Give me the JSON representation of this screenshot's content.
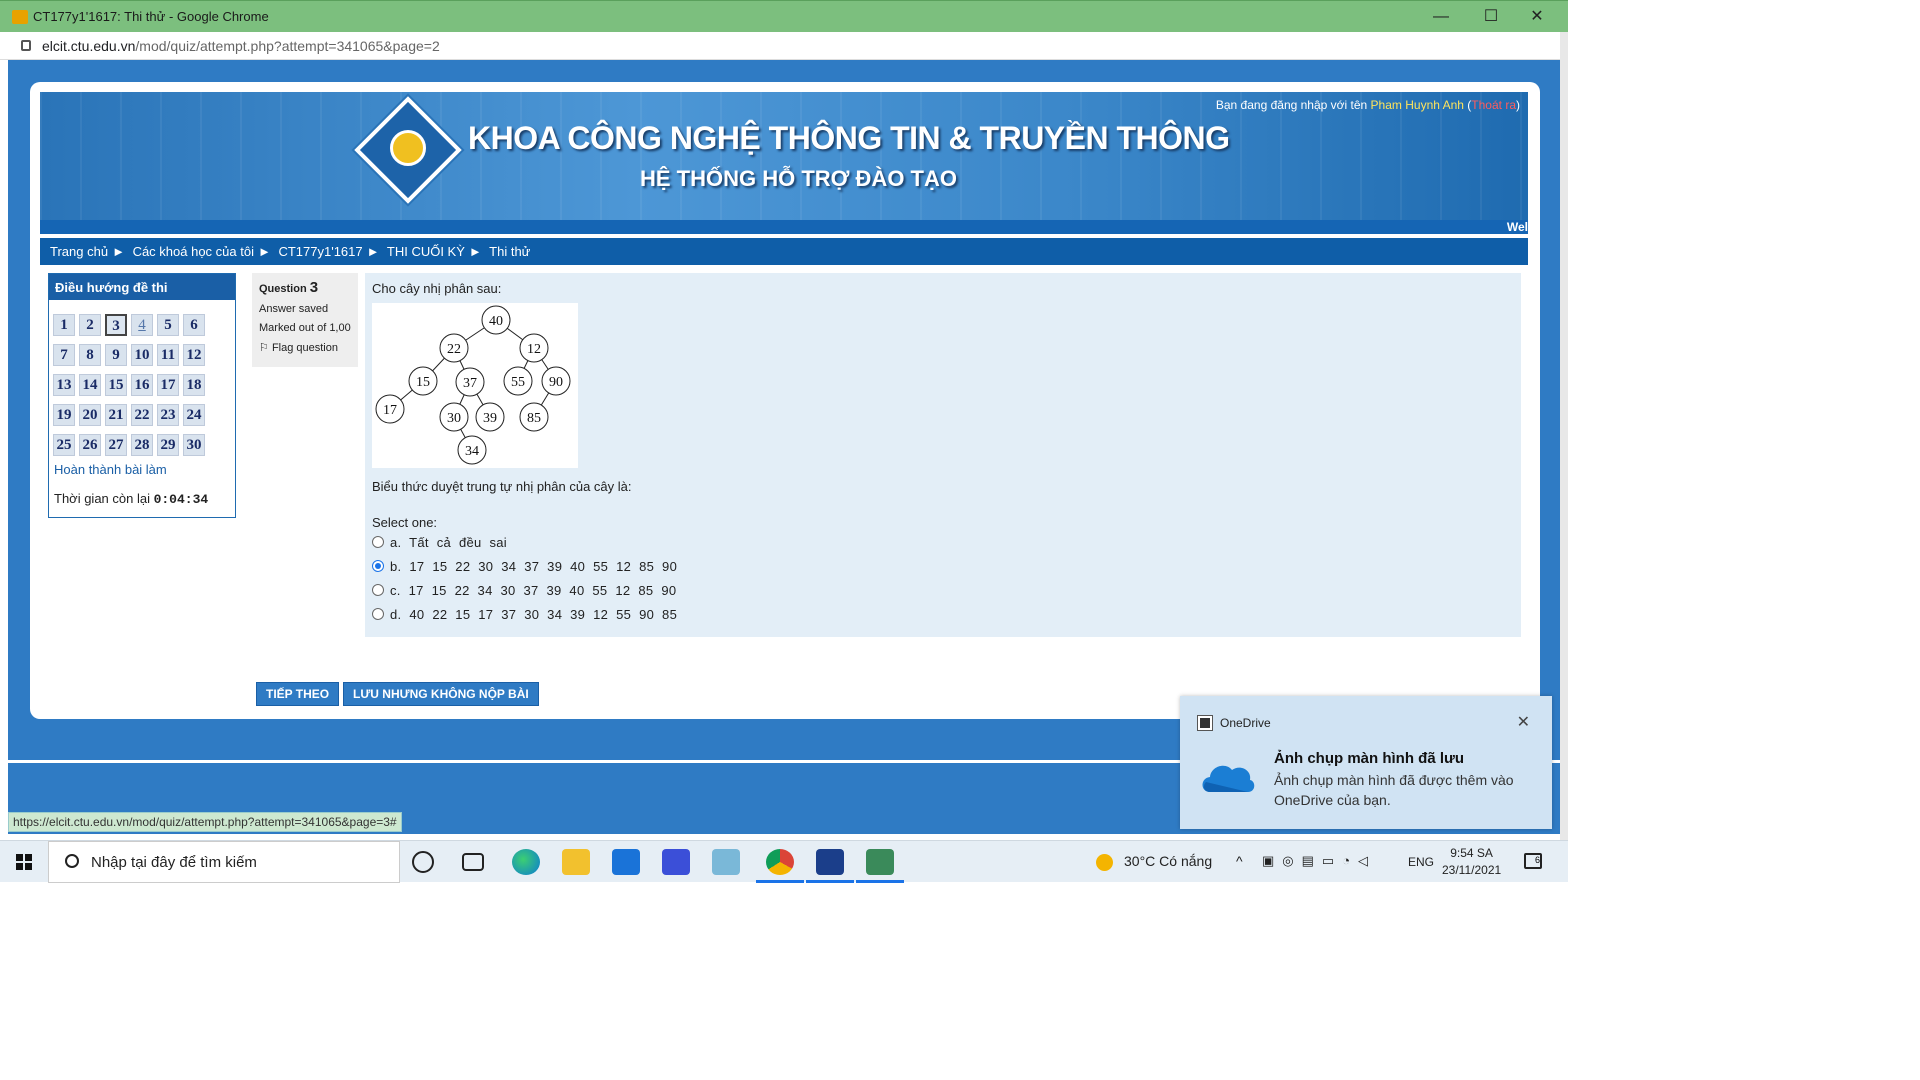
{
  "window": {
    "title": "CT177y1'1617: Thi thử - Google Chrome",
    "minimize": "—",
    "maximize": "☐",
    "close": "✕"
  },
  "address": {
    "domain": "elcit.ctu.edu.vn",
    "path": "/mod/quiz/attempt.php?attempt=341065&page=2"
  },
  "banner": {
    "heading": "KHOA CÔNG NGHỆ THÔNG TIN & TRUYỀN THÔNG",
    "subheading": "HỆ THỐNG HỖ TRỢ ĐÀO TẠO",
    "login_prefix": "Bạn đang đăng nhập với tên ",
    "user": "Pham Huynh Anh",
    "logout": "Thoát ra",
    "marquee": "Wel"
  },
  "breadcrumb": [
    "Trang chủ",
    "Các khoá học của tôi",
    "CT177y1'1617",
    "THI CUỐI KỲ",
    "Thi thử"
  ],
  "breadcrumb_sep": "►",
  "nav": {
    "title": "Điều hướng đề thi",
    "questions": [
      "1",
      "2",
      "3",
      "4",
      "5",
      "6",
      "7",
      "8",
      "9",
      "10",
      "11",
      "12",
      "13",
      "14",
      "15",
      "16",
      "17",
      "18",
      "19",
      "20",
      "21",
      "22",
      "23",
      "24",
      "25",
      "26",
      "27",
      "28",
      "29",
      "30"
    ],
    "current": "3",
    "finish": "Hoàn thành bài làm",
    "time_label": "Thời gian còn lại ",
    "time_value": "0:04:34"
  },
  "qinfo": {
    "label": "Question ",
    "number": "3",
    "state": "Answer saved",
    "marks": "Marked out of 1,00",
    "flag": "Flag question"
  },
  "question": {
    "stem": "Cho cây nhị phân sau:",
    "prompt": "Biểu thức duyệt trung tự nhị phân của cây là:",
    "select": "Select one:",
    "tree_nodes": [
      "40",
      "22",
      "12",
      "15",
      "37",
      "55",
      "90",
      "17",
      "30",
      "39",
      "85",
      "34"
    ],
    "options": [
      {
        "text": "a. Tất cả đều sai",
        "selected": false
      },
      {
        "text": "b. 17  15  22   30  34  37  39  40  55  12  85  90",
        "selected": true
      },
      {
        "text": "c. 17  15  22   34  30  37  39  40  55  12  85  90",
        "selected": false
      },
      {
        "text": "d. 40  22  15  17   37  30  34  39  12  55  90  85",
        "selected": false
      }
    ]
  },
  "buttons": {
    "next": "TIẾP THEO",
    "save": "LƯU NHƯNG KHÔNG NỘP BÀI"
  },
  "status_url": "https://elcit.ctu.edu.vn/mod/quiz/attempt.php?attempt=341065&page=3#",
  "toast": {
    "app": "OneDrive",
    "title": "Ảnh chụp màn hình đã lưu",
    "body": "Ảnh chụp màn hình đã được thêm vào OneDrive của bạn."
  },
  "taskbar": {
    "search_placeholder": "Nhập tại đây để tìm kiếm",
    "weather": "30°C  Có nắng",
    "lang": "ENG",
    "time": "9:54 SA",
    "date": "23/11/2021",
    "notif_count": "6"
  }
}
